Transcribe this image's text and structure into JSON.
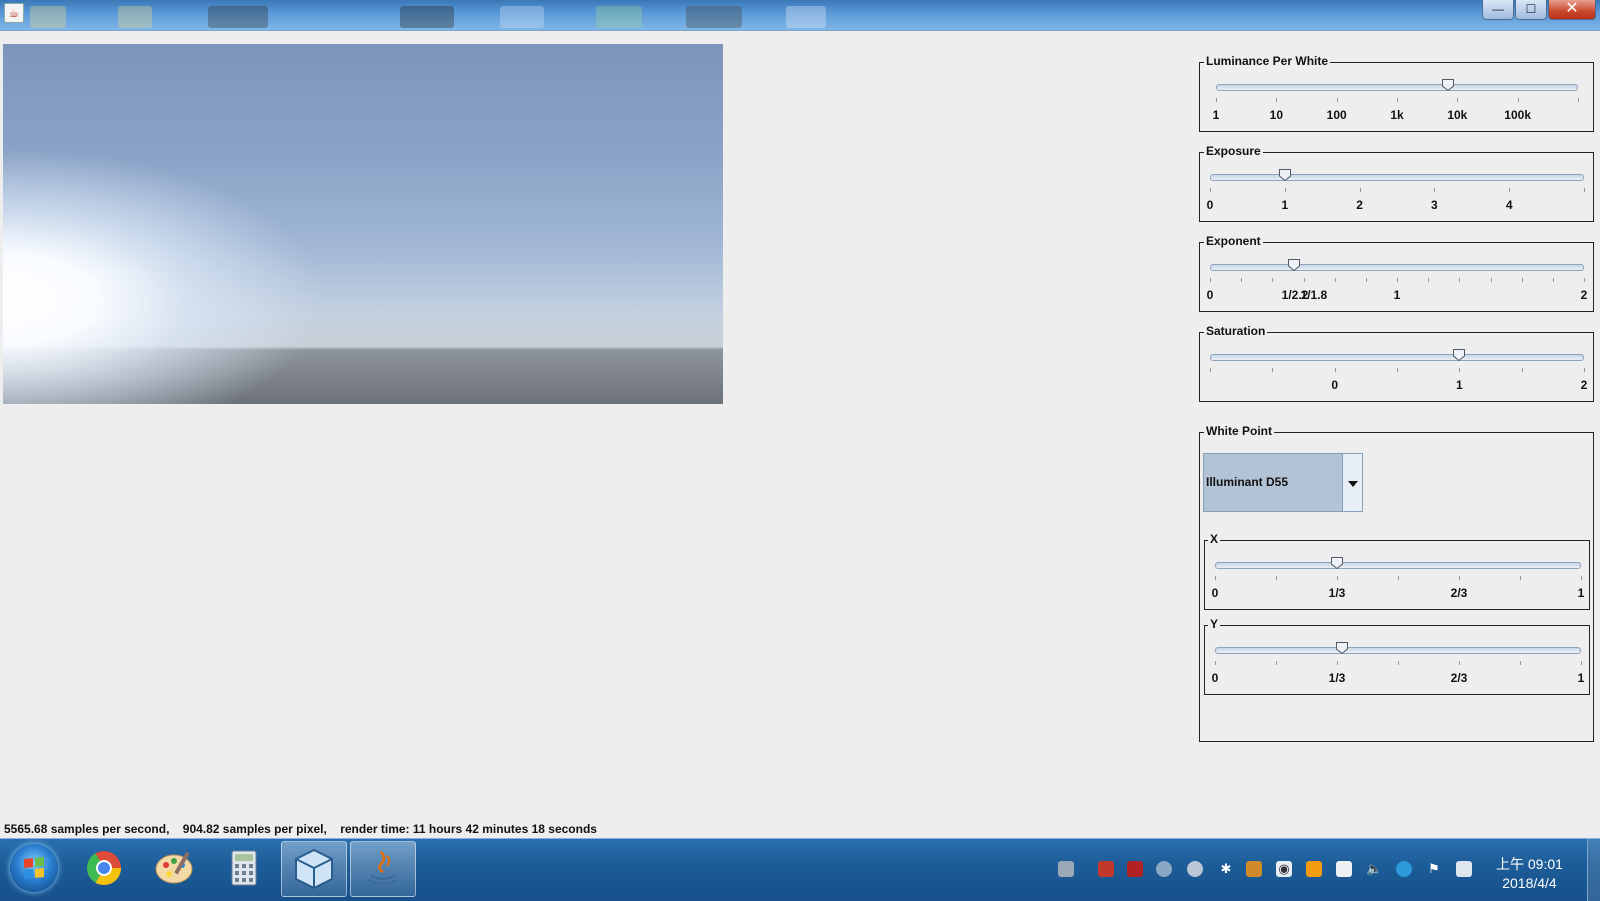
{
  "window": {
    "app_icon": "java-coffee-icon",
    "minimize_label": "—",
    "maximize_label": "☐",
    "close_label": "✕"
  },
  "panels": {
    "luminance": {
      "title": "Luminance Per White",
      "value_fraction": 0.64,
      "labels": [
        "1",
        "10",
        "100",
        "1k",
        "10k",
        "100k"
      ]
    },
    "exposure": {
      "title": "Exposure",
      "value": 1.0,
      "labels": [
        "0",
        "1",
        "2",
        "3",
        "4"
      ]
    },
    "exponent": {
      "title": "Exponent",
      "value": 0.45,
      "labels": [
        "0",
        "1/2.2",
        "1/1.8",
        "1",
        "2"
      ]
    },
    "saturation": {
      "title": "Saturation",
      "value": 1.0,
      "labels": [
        "0",
        "1",
        "2"
      ]
    },
    "white_point": {
      "title": "White Point",
      "selected": "Illuminant D55",
      "x": {
        "title": "X",
        "value": 0.3324,
        "labels": [
          "0",
          "1/3",
          "2/3",
          "1"
        ]
      },
      "y": {
        "title": "Y",
        "value": 0.3474,
        "labels": [
          "0",
          "1/3",
          "2/3",
          "1"
        ]
      }
    }
  },
  "status": {
    "text": "5565.68 samples per second,    904.82 samples per pixel,    render time: 11 hours 42 minutes 18 seconds"
  },
  "taskbar": {
    "apps": [
      "start-orb",
      "chrome-icon",
      "paint-icon",
      "calculator-icon",
      "cube-app-icon",
      "java-app-icon"
    ],
    "clock_time": "上午 09:01",
    "clock_date": "2018/4/4"
  }
}
